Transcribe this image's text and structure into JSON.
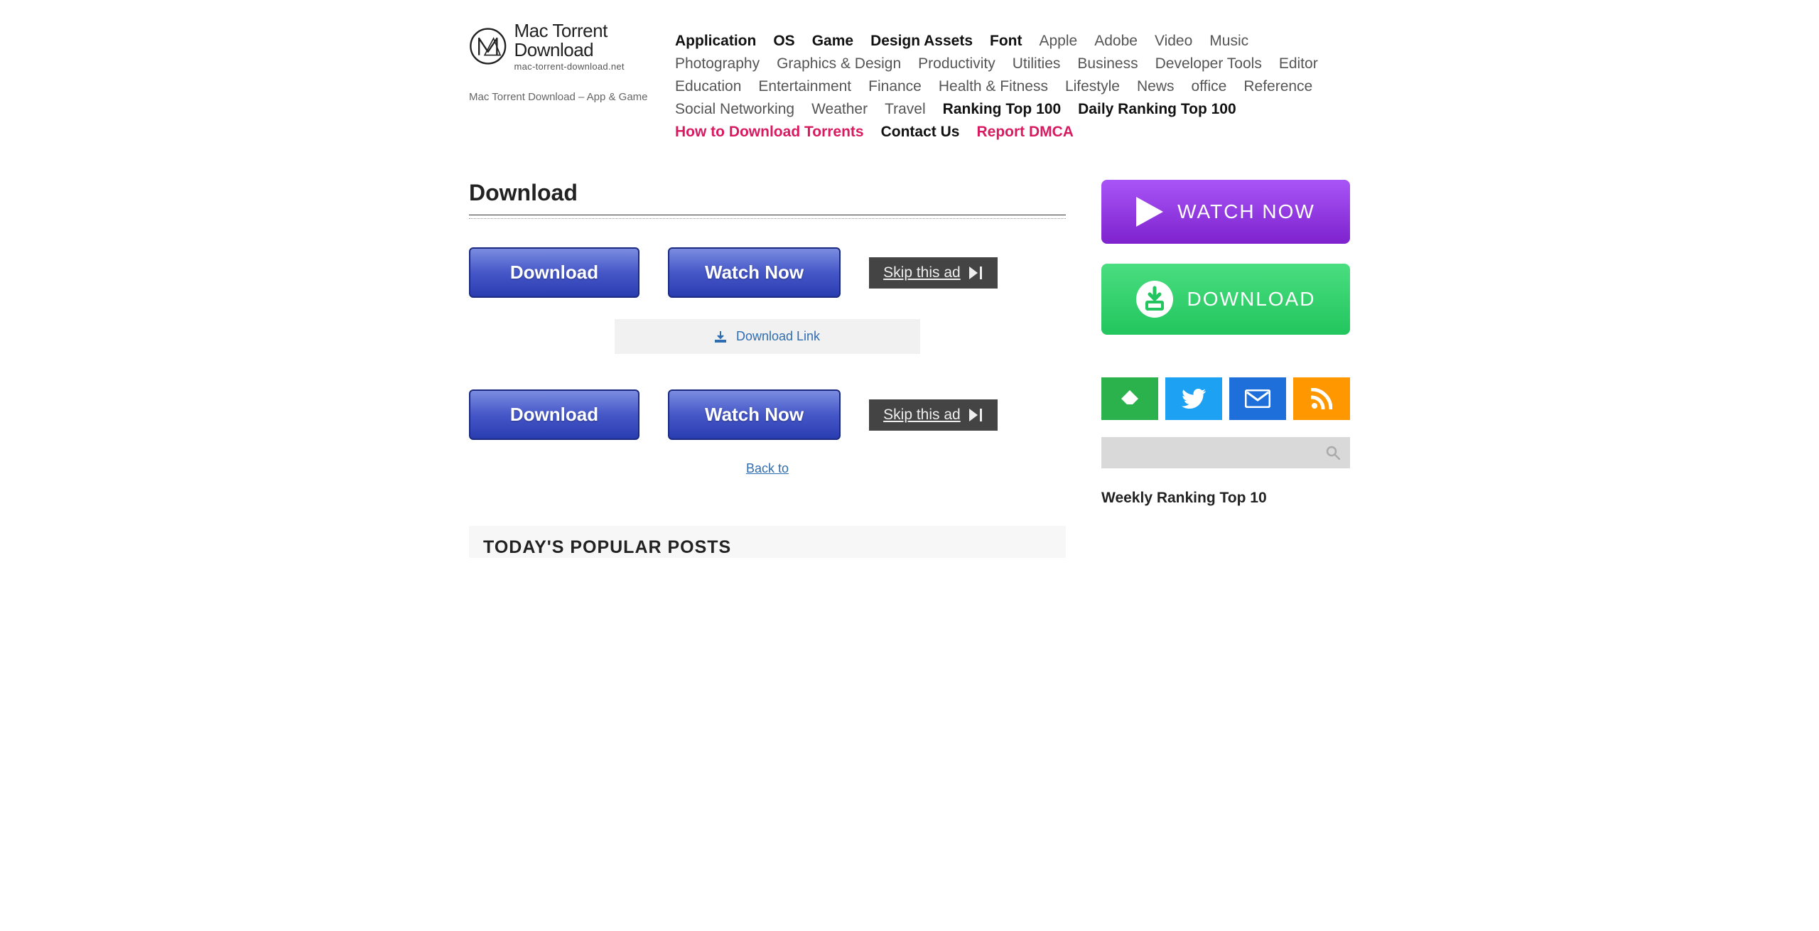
{
  "logo": {
    "title": "Mac Torrent Download",
    "sub": "mac-torrent-download.net"
  },
  "tagline": "Mac Torrent Download – App & Game",
  "nav": [
    {
      "label": "Application",
      "style": "bold"
    },
    {
      "label": "OS",
      "style": "bold"
    },
    {
      "label": "Game",
      "style": "bold"
    },
    {
      "label": "Design Assets",
      "style": "bold"
    },
    {
      "label": "Font",
      "style": "bold"
    },
    {
      "label": "Apple",
      "style": ""
    },
    {
      "label": "Adobe",
      "style": ""
    },
    {
      "label": "Video",
      "style": ""
    },
    {
      "label": "Music",
      "style": ""
    },
    {
      "label": "Photography",
      "style": ""
    },
    {
      "label": "Graphics & Design",
      "style": ""
    },
    {
      "label": "Productivity",
      "style": ""
    },
    {
      "label": "Utilities",
      "style": ""
    },
    {
      "label": "Business",
      "style": ""
    },
    {
      "label": "Developer Tools",
      "style": ""
    },
    {
      "label": "Editor",
      "style": ""
    },
    {
      "label": "Education",
      "style": ""
    },
    {
      "label": "Entertainment",
      "style": ""
    },
    {
      "label": "Finance",
      "style": ""
    },
    {
      "label": "Health & Fitness",
      "style": ""
    },
    {
      "label": "Lifestyle",
      "style": ""
    },
    {
      "label": "News",
      "style": ""
    },
    {
      "label": "office",
      "style": ""
    },
    {
      "label": "Reference",
      "style": ""
    },
    {
      "label": "Social Networking",
      "style": ""
    },
    {
      "label": "Weather",
      "style": ""
    },
    {
      "label": "Travel",
      "style": ""
    },
    {
      "label": "Ranking Top 100",
      "style": "black"
    },
    {
      "label": "Daily Ranking Top 100",
      "style": "black"
    },
    {
      "label": "How to Download Torrents",
      "style": "red"
    },
    {
      "label": "Contact Us",
      "style": "black"
    },
    {
      "label": "Report DMCA",
      "style": "red"
    }
  ],
  "page_title": "Download",
  "ad": {
    "download_label": "Download",
    "watch_label": "Watch Now",
    "skip_label": "Skip this ad"
  },
  "download_link_label": "Download Link",
  "back_to_label": "Back to",
  "todays_posts": "TODAY'S POPULAR POSTS",
  "sidebar": {
    "watch_now": "WATCH NOW",
    "download": "DOWNLOAD",
    "weekly_title": "Weekly Ranking Top 10"
  }
}
